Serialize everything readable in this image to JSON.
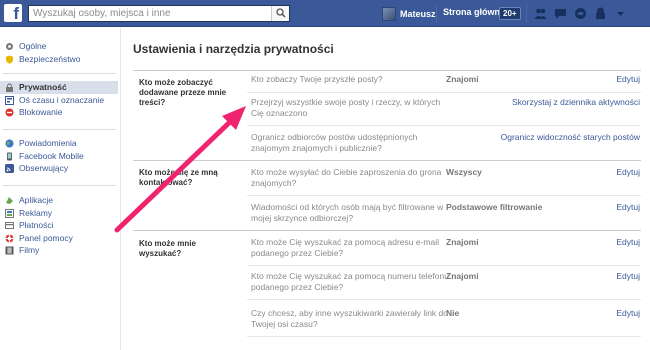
{
  "topbar": {
    "logo": "f",
    "search_placeholder": "Wyszukaj osoby, miejsca i inne",
    "user_name": "Mateusz",
    "home_label": "Strona główna",
    "home_count": "20+"
  },
  "sidebar": {
    "group1": [
      {
        "label": "Ogólne",
        "icon": "gear-icon"
      },
      {
        "label": "Bezpieczeństwo",
        "icon": "shield-icon"
      }
    ],
    "group2": [
      {
        "label": "Prywatność",
        "icon": "lock-icon",
        "active": true
      },
      {
        "label": "Oś czasu i oznaczanie",
        "icon": "timeline-icon"
      },
      {
        "label": "Blokowanie",
        "icon": "block-icon"
      }
    ],
    "group3": [
      {
        "label": "Powiadomienia",
        "icon": "globe-icon"
      },
      {
        "label": "Facebook Mobile",
        "icon": "mobile-icon"
      },
      {
        "label": "Obserwujący",
        "icon": "rss-icon"
      }
    ],
    "group4": [
      {
        "label": "Aplikacje",
        "icon": "apps-icon"
      },
      {
        "label": "Reklamy",
        "icon": "ads-icon"
      },
      {
        "label": "Płatności",
        "icon": "card-icon"
      },
      {
        "label": "Panel pomocy",
        "icon": "lifebuoy-icon"
      },
      {
        "label": "Filmy",
        "icon": "film-icon"
      }
    ]
  },
  "main": {
    "title": "Ustawienia i narzędzia prywatności",
    "sections": [
      {
        "label": "Kto może zobaczyć dodawane przeze mnie treści?",
        "rows": [
          {
            "question": "Kto zobaczy Twoje przyszłe posty?",
            "value": "Znajomi",
            "action": "Edytuj"
          },
          {
            "question": "Przejrzyj wszystkie swoje posty i rzeczy, w których Cię oznaczono",
            "value": "",
            "action": "Skorzystaj z dziennika aktywności"
          },
          {
            "question": "Ogranicz odbiorców postów udostępnionych znajomym znajomych i publicznie?",
            "value": "",
            "action": "Ogranicz widoczność starych postów"
          }
        ]
      },
      {
        "label": "Kto może się ze mną kontaktować?",
        "rows": [
          {
            "question": "Kto może wysyłać do Ciebie zaproszenia do grona znajomych?",
            "value": "Wszyscy",
            "action": "Edytuj"
          },
          {
            "question": "Wiadomości od których osób mają być filtrowane w mojej skrzynce odbiorczej?",
            "value": "Podstawowe filtrowanie",
            "action": "Edytuj"
          }
        ]
      },
      {
        "label": "Kto może mnie wyszukać?",
        "rows": [
          {
            "question": "Kto może Cię wyszukać za pomocą adresu e-mail podanego przez Ciebie?",
            "value": "Znajomi",
            "action": "Edytuj"
          },
          {
            "question": "Kto może Cię wyszukać za pomocą numeru telefonu podanego przez Ciebie?",
            "value": "Znajomi",
            "action": "Edytuj"
          },
          {
            "question": "Czy chcesz, aby inne wyszukiwarki zawierały link do Twojej osi czasu?",
            "value": "Nie",
            "action": "Edytuj"
          }
        ]
      }
    ]
  },
  "colors": {
    "brand": "#3b5998",
    "arrow": "#f0246e"
  }
}
